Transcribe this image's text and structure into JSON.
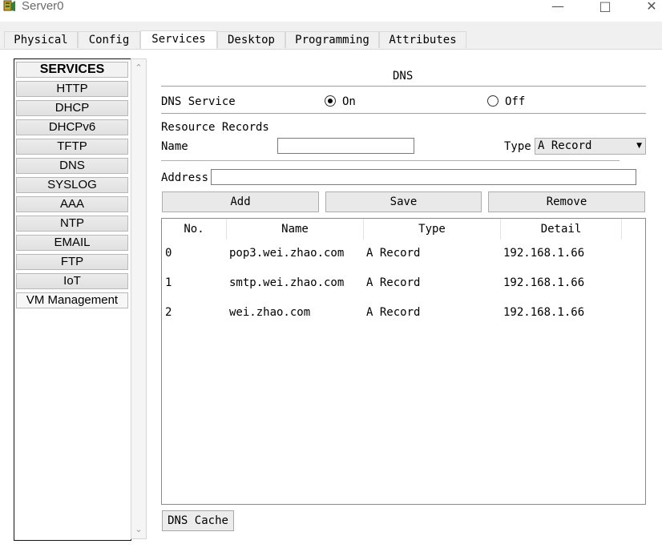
{
  "window": {
    "title": "Server0"
  },
  "tabs": [
    "Physical",
    "Config",
    "Services",
    "Desktop",
    "Programming",
    "Attributes"
  ],
  "active_tab": "Services",
  "sidebar": {
    "header": "SERVICES",
    "items": [
      "HTTP",
      "DHCP",
      "DHCPv6",
      "TFTP",
      "DNS",
      "SYSLOG",
      "AAA",
      "NTP",
      "EMAIL",
      "FTP",
      "IoT",
      "VM Management"
    ]
  },
  "dns": {
    "title": "DNS",
    "service_label": "DNS Service",
    "on_label": "On",
    "off_label": "Off",
    "service_state": "On",
    "resource_records_label": "Resource Records",
    "name_label": "Name",
    "name_value": "",
    "type_label": "Type",
    "type_value": "A Record",
    "address_label": "Address",
    "address_value": "",
    "buttons": {
      "add": "Add",
      "save": "Save",
      "remove": "Remove",
      "cache": "DNS Cache"
    },
    "table": {
      "columns": [
        "No.",
        "Name",
        "Type",
        "Detail"
      ],
      "rows": [
        [
          "0",
          "pop3.wei.zhao.com",
          "A Record",
          "192.168.1.66"
        ],
        [
          "1",
          "smtp.wei.zhao.com",
          "A Record",
          "192.168.1.66"
        ],
        [
          "2",
          "wei.zhao.com",
          "A Record",
          "192.168.1.66"
        ]
      ]
    }
  },
  "icons": {
    "app": "server-app-icon",
    "minimize": "minimize-icon",
    "maximize": "maximize-icon",
    "close": "close-icon",
    "dropdown": "chevron-down-icon",
    "scroll_up": "scroll-up-icon",
    "scroll_down": "scroll-down-icon"
  },
  "colors": {
    "tab_bar": "#f0f0f0",
    "button_face": "#e9e9e9",
    "border": "#adadad"
  }
}
